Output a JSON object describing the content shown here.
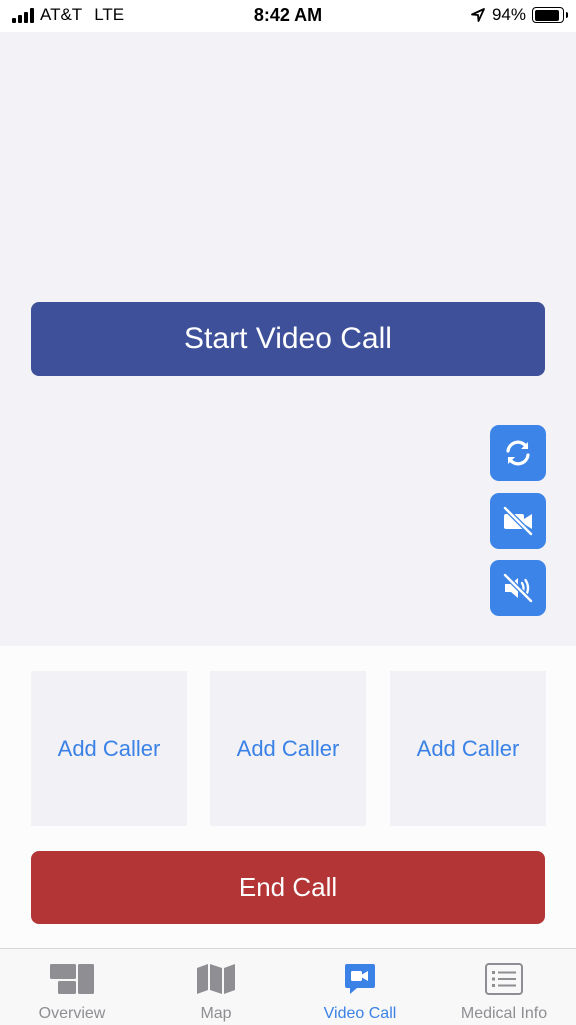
{
  "status_bar": {
    "carrier": "AT&T",
    "network": "LTE",
    "time": "8:42 AM",
    "battery": "94%"
  },
  "video": {
    "start_label": "Start Video Call"
  },
  "controls": {
    "switch_camera_icon": "camera-switch-icon",
    "video_off_icon": "video-off-icon",
    "mute_icon": "speaker-mute-icon",
    "color": "#3c84e8"
  },
  "callers": [
    {
      "label": "Add Caller"
    },
    {
      "label": "Add Caller"
    },
    {
      "label": "Add Caller"
    }
  ],
  "end_call": {
    "label": "End Call",
    "color": "#b33536"
  },
  "tabs": [
    {
      "label": "Overview",
      "icon": "overview-icon",
      "active": false
    },
    {
      "label": "Map",
      "icon": "map-icon",
      "active": false
    },
    {
      "label": "Video Call",
      "icon": "video-call-icon",
      "active": true
    },
    {
      "label": "Medical Info",
      "icon": "medical-info-icon",
      "active": false
    }
  ],
  "colors": {
    "accent": "#3b82e6",
    "start_button": "#3e509a",
    "inactive_tab": "#8e8e93"
  }
}
